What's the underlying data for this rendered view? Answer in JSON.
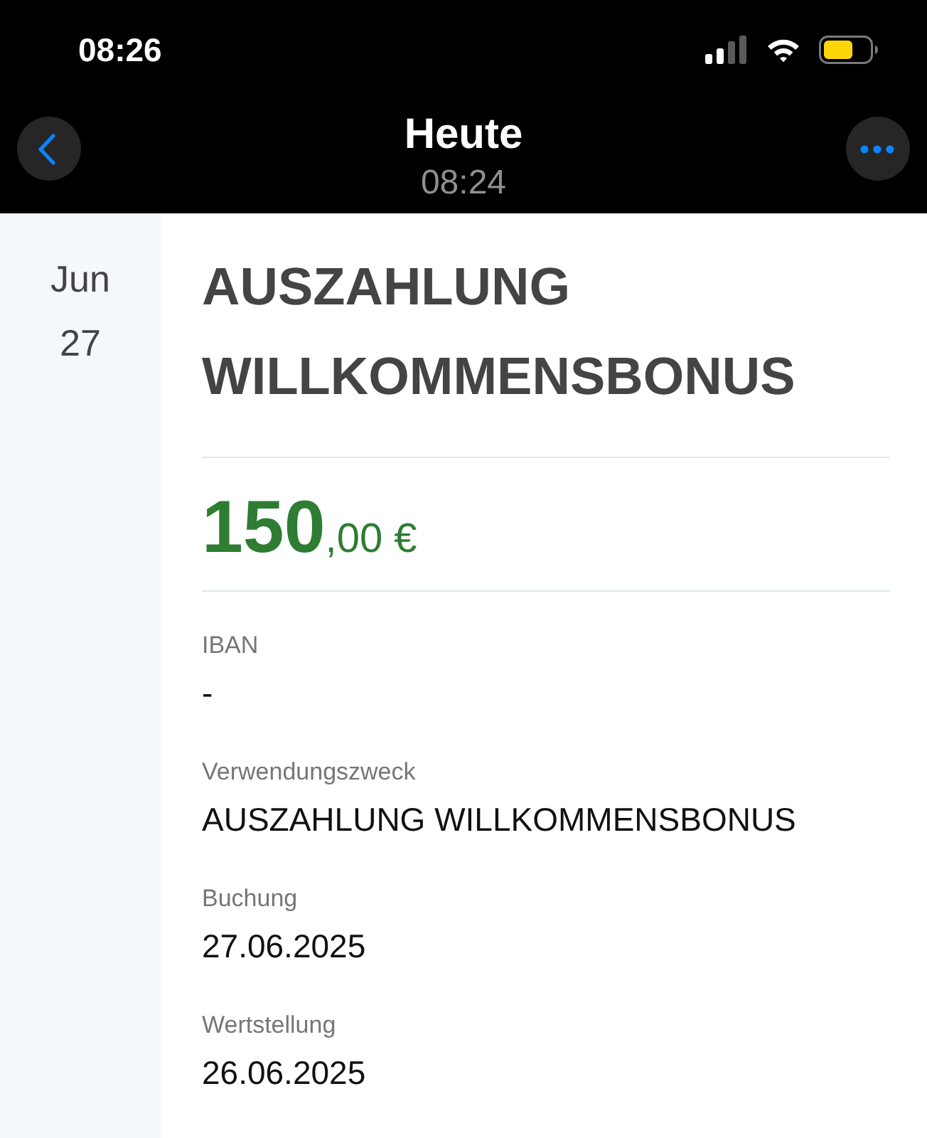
{
  "status_bar": {
    "time": "08:26"
  },
  "nav": {
    "title": "Heute",
    "subtitle": "08:24"
  },
  "date": {
    "month": "Jun",
    "day": "27"
  },
  "transaction": {
    "title": "AUSZAHLUNG WILLKOMMENSBONUS",
    "amount": "**150**,00 €",
    "fields": [
      {
        "label": "IBAN",
        "value": "-"
      },
      {
        "label": "Verwendungszweck",
        "value": "AUSZAHLUNG WILLKOMMENSBONUS"
      },
      {
        "label": "Buchung",
        "value": "27.06.2025"
      },
      {
        "label": "Wertstellung",
        "value": "26.06.2025"
      }
    ]
  }
}
